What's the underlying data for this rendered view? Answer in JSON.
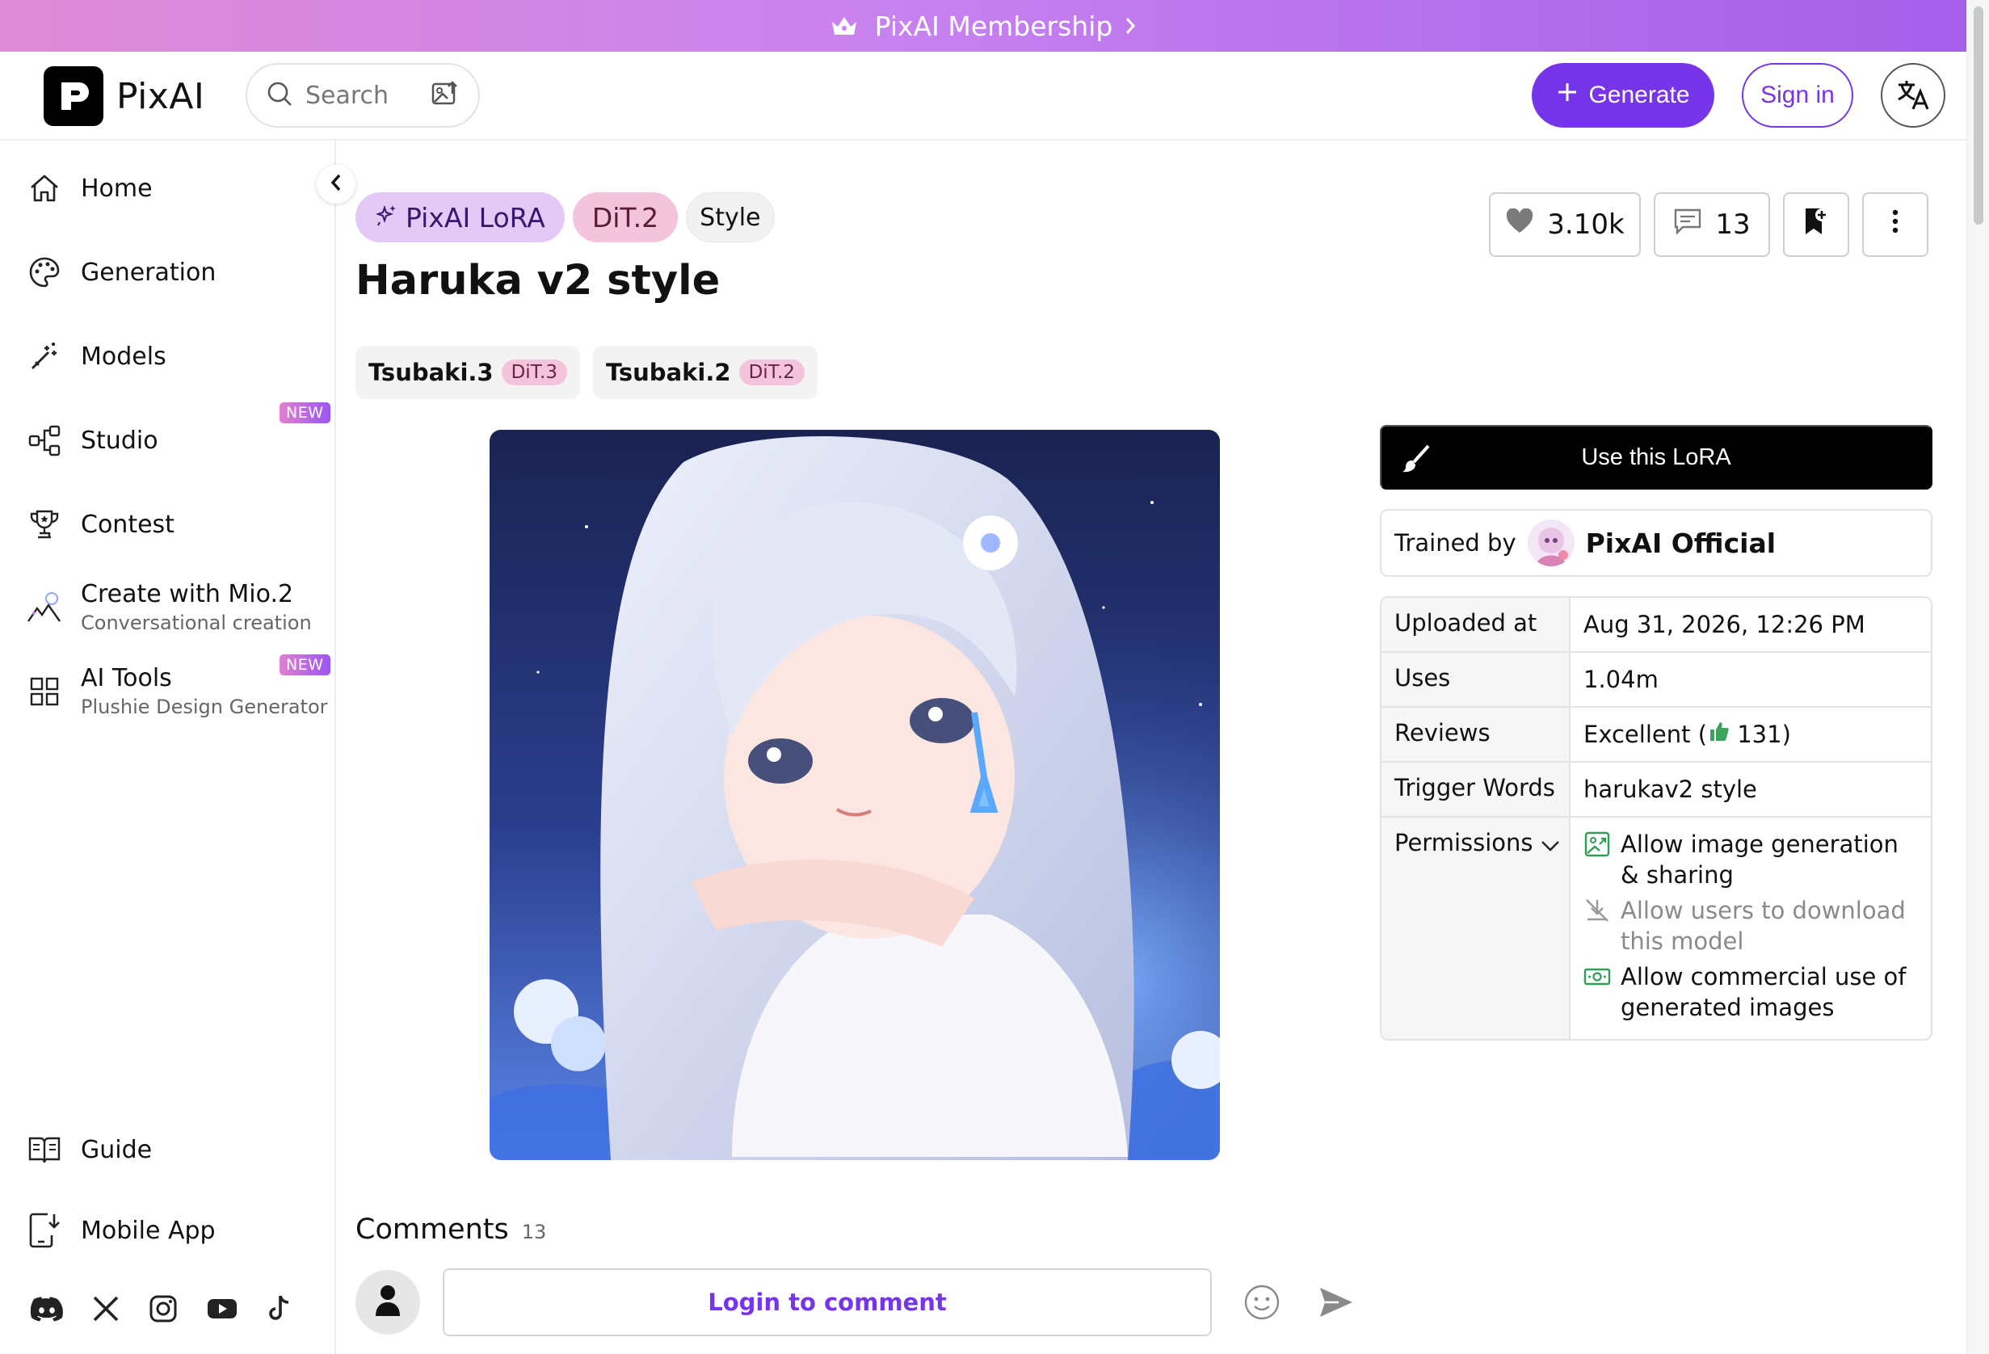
{
  "promo": {
    "label": "PixAI Membership"
  },
  "header": {
    "logo_text": "PixAI",
    "search_placeholder": "Search",
    "generate_label": "Generate",
    "signin_label": "Sign in"
  },
  "sidebar": {
    "items": [
      {
        "label": "Home"
      },
      {
        "label": "Generation"
      },
      {
        "label": "Models"
      },
      {
        "label": "Studio",
        "badge": "NEW"
      },
      {
        "label": "Contest"
      },
      {
        "label": "Create with Mio.2",
        "sub": "Conversational creation"
      },
      {
        "label": "AI Tools",
        "sub": "Plushie Design Generator",
        "badge": "NEW"
      }
    ],
    "bottom": [
      {
        "label": "Guide"
      },
      {
        "label": "Mobile App"
      }
    ],
    "socials": [
      "discord-icon",
      "x-icon",
      "instagram-icon",
      "youtube-icon",
      "tiktok-icon"
    ]
  },
  "model": {
    "tags": [
      "PixAI LoRA",
      "DiT.2",
      "Style"
    ],
    "title": "Haruka v2 style",
    "versions": [
      {
        "name": "Tsubaki.3",
        "base": "DiT.3"
      },
      {
        "name": "Tsubaki.2",
        "base": "DiT.2"
      }
    ],
    "likes": "3.10k",
    "comments_count": "13"
  },
  "panel": {
    "use_label": "Use this LoRA",
    "trained_by_label": "Trained by",
    "trainer": "PixAI Official",
    "info": {
      "uploaded_key": "Uploaded at",
      "uploaded_val": "Aug 31, 2026, 12:26 PM",
      "uses_key": "Uses",
      "uses_val": "1.04m",
      "reviews_key": "Reviews",
      "reviews_val": "Excellent",
      "reviews_count": "131",
      "trigger_key": "Trigger Words",
      "trigger_val": "harukav2 style",
      "permissions_key": "Permissions",
      "permissions": [
        {
          "text": "Allow image generation & sharing",
          "enabled": true
        },
        {
          "text": "Allow users to download this model",
          "enabled": false
        },
        {
          "text": "Allow commercial use of generated images",
          "enabled": true
        }
      ]
    }
  },
  "comments": {
    "title": "Comments",
    "count": "13",
    "login_label": "Login to comment"
  },
  "colors": {
    "accent": "#7635e8",
    "lora_tag": "#e4c8f5",
    "dit_tag": "#f4c3dc"
  }
}
